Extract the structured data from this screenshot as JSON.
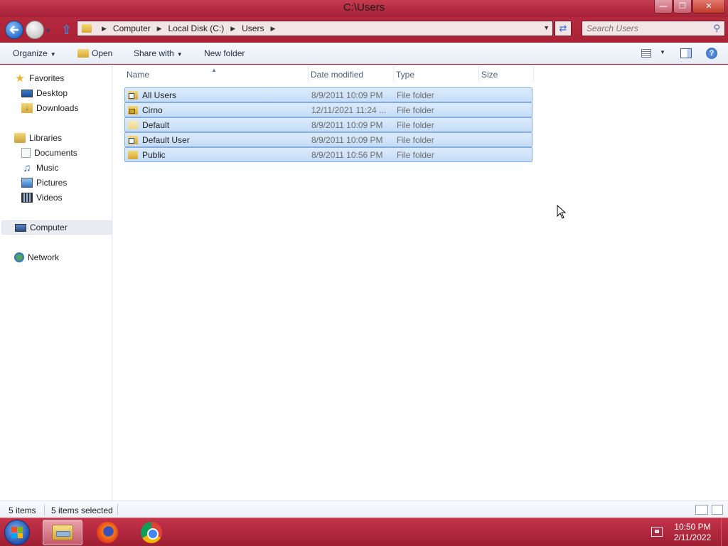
{
  "window": {
    "title": "C:\\Users"
  },
  "navigation": {
    "breadcrumb": [
      "Computer",
      "Local Disk (C:)",
      "Users"
    ],
    "search_placeholder": "Search Users"
  },
  "toolbar": {
    "organize": "Organize",
    "open": "Open",
    "share_with": "Share with",
    "new_folder": "New folder"
  },
  "nav_pane": {
    "favorites": "Favorites",
    "desktop": "Desktop",
    "downloads": "Downloads",
    "libraries": "Libraries",
    "documents": "Documents",
    "music": "Music",
    "pictures": "Pictures",
    "videos": "Videos",
    "computer": "Computer",
    "network": "Network"
  },
  "columns": {
    "name": "Name",
    "date_modified": "Date modified",
    "type": "Type",
    "size": "Size"
  },
  "files": [
    {
      "name": "All Users",
      "date": "8/9/2011 10:09 PM",
      "type": "File folder",
      "size": "",
      "icon": "shortcut-folder-icon"
    },
    {
      "name": "Cirno",
      "date": "12/11/2021 11:24 ...",
      "type": "File folder",
      "size": "",
      "icon": "locked-folder-icon"
    },
    {
      "name": "Default",
      "date": "8/9/2011 10:09 PM",
      "type": "File folder",
      "size": "",
      "icon": "hidden-folder-icon"
    },
    {
      "name": "Default User",
      "date": "8/9/2011 10:09 PM",
      "type": "File folder",
      "size": "",
      "icon": "shortcut-folder-icon"
    },
    {
      "name": "Public",
      "date": "8/9/2011 10:56 PM",
      "type": "File folder",
      "size": "",
      "icon": "folder-icon"
    }
  ],
  "status": {
    "item_count": "5 items",
    "selected_count": "5 items selected"
  },
  "taskbar": {
    "time": "10:50 PM",
    "date": "2/11/2022"
  },
  "colors": {
    "accent": "#b8283d",
    "selection": "#c5dcf7"
  }
}
